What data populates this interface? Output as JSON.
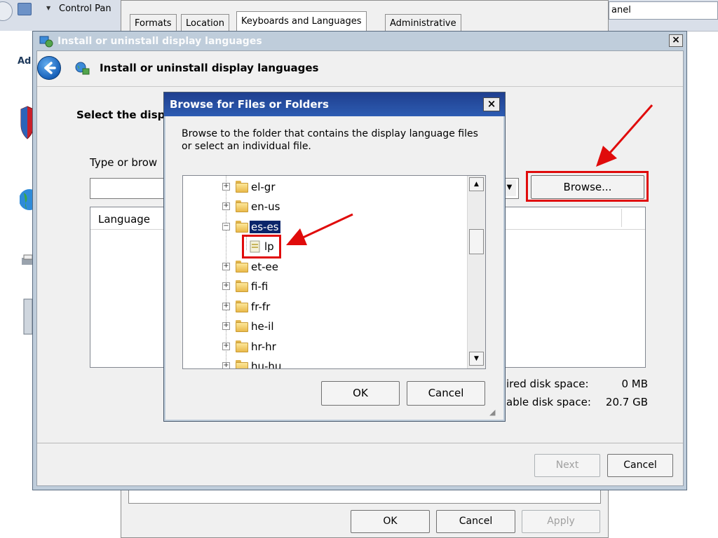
{
  "control_panel": {
    "breadcrumb": "Control Pan",
    "search_text": "anel",
    "left_partial_text": "Ad"
  },
  "region_dialog": {
    "tabs": [
      "Formats",
      "Location",
      "Keyboards and Languages",
      "Administrative"
    ],
    "active_tab_index": 2,
    "buttons": {
      "ok": "OK",
      "cancel": "Cancel",
      "apply": "Apply"
    }
  },
  "install_window": {
    "title": "Install or uninstall display languages",
    "header_title": "Install or uninstall display languages",
    "instruction": "Select the disp",
    "path_label": "Type or brow",
    "path_value": "",
    "browse_label": "Browse...",
    "list_header": "Language",
    "required_label": "ired disk space:",
    "required_value": "0 MB",
    "available_label": "able disk space:",
    "available_value": "20.7 GB",
    "next_label": "Next",
    "cancel_label": "Cancel"
  },
  "browse_dialog": {
    "title": "Browse for Files or Folders",
    "description": "Browse to the folder that contains the display language files or select an individual file.",
    "tree": [
      {
        "label": "el-gr",
        "expander": "+",
        "type": "folder"
      },
      {
        "label": "en-us",
        "expander": "+",
        "type": "folder"
      },
      {
        "label": "es-es",
        "expander": "−",
        "type": "folder",
        "selected": true
      },
      {
        "label": "lp",
        "expander": "",
        "type": "file",
        "child": true
      },
      {
        "label": "et-ee",
        "expander": "+",
        "type": "folder"
      },
      {
        "label": "fi-fi",
        "expander": "+",
        "type": "folder"
      },
      {
        "label": "fr-fr",
        "expander": "+",
        "type": "folder"
      },
      {
        "label": "he-il",
        "expander": "+",
        "type": "folder"
      },
      {
        "label": "hr-hr",
        "expander": "+",
        "type": "folder"
      },
      {
        "label": "hu-hu",
        "expander": "+",
        "type": "folder"
      }
    ],
    "ok_label": "OK",
    "cancel_label": "Cancel"
  },
  "annotation_color": "#e00b0b"
}
